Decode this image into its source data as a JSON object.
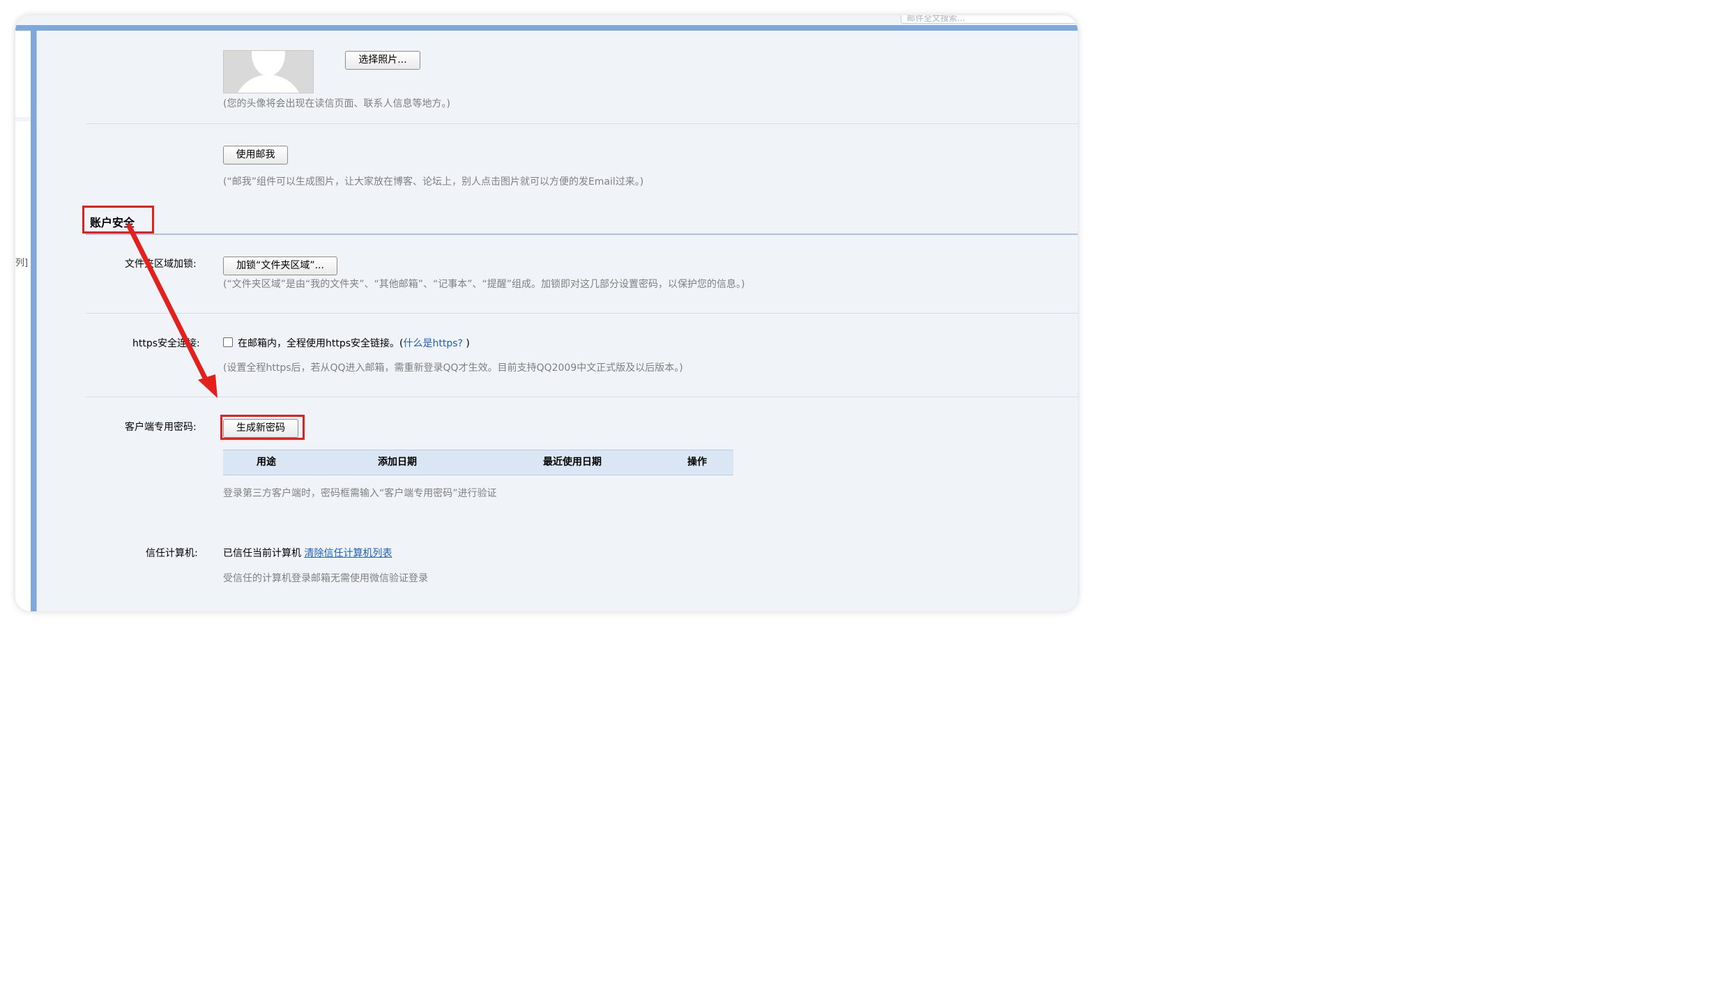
{
  "search": {
    "placeholder": "邮件全文搜索..."
  },
  "left_fragment": "列]",
  "avatar": {
    "choose_button": "选择照片...",
    "hint": "(您的头像将会出现在读信页面、联系人信息等地方。)"
  },
  "mailme": {
    "button": "使用邮我",
    "hint": "(“邮我”组件可以生成图片，让大家放在博客、论坛上，别人点击图片就可以方便的发Email过来。)"
  },
  "account_security": {
    "title": "账户安全",
    "folder_lock": {
      "label": "文件夹区域加锁:",
      "button": "加锁“文件夹区域”...",
      "hint": "(“文件夹区域”是由“我的文件夹”、“其他邮箱”、“记事本”、“提醒”组成。加锁即对这几部分设置密码，以保护您的信息。)"
    },
    "https": {
      "label": "https安全连接:",
      "checkbox_text": "在邮箱内，全程使用https安全链接。(",
      "link": "什么是https?",
      "close_paren": " )",
      "checked": false,
      "hint": "(设置全程https后，若从QQ进入邮箱，需重新登录QQ才生效。目前支持QQ2009中文正式版及以后版本。)"
    },
    "client_password": {
      "label": "客户端专用密码:",
      "button": "生成新密码",
      "columns": [
        "用途",
        "添加日期",
        "最近使用日期",
        "操作"
      ],
      "hint": "登录第三方客户端时，密码框需输入“客户端专用密码”进行验证"
    },
    "trusted_computer": {
      "label": "信任计算机:",
      "status": "已信任当前计算机",
      "clear_link": "清除信任计算机列表",
      "hint": "受信任的计算机登录邮箱无需使用微信验证登录"
    }
  },
  "colors": {
    "accent_blue": "#7ea8da",
    "annotation_red": "#e3201b",
    "link_blue": "#1d5fbf",
    "content_bg": "#f0f4f9"
  }
}
